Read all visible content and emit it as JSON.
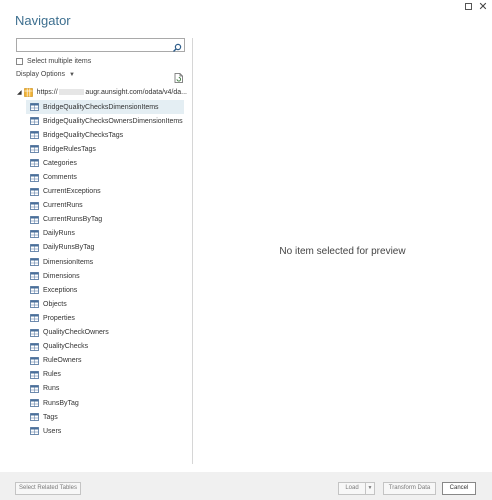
{
  "window": {
    "title": "Navigator",
    "maximize_label": "",
    "close_label": "✕"
  },
  "search": {
    "value": "",
    "placeholder": ""
  },
  "select_multiple": {
    "label": "Select multiple items",
    "checked": false
  },
  "display_options": {
    "label": "Display Options",
    "caret": "▼"
  },
  "tree": {
    "root": {
      "expander": "◢",
      "url_prefix": "https://",
      "url_suffix": "augr.aunsight.com/odata/v4/da..."
    },
    "items": [
      "BridgeQualityChecksDimensionItems",
      "BridgeQualityChecksOwnersDimensionItems",
      "BridgeQualityChecksTags",
      "BridgeRulesTags",
      "Categories",
      "Comments",
      "CurrentExceptions",
      "CurrentRuns",
      "CurrentRunsByTag",
      "DailyRuns",
      "DailyRunsByTag",
      "DimensionItems",
      "Dimensions",
      "Exceptions",
      "Objects",
      "Properties",
      "QualityCheckOwners",
      "QualityChecks",
      "RuleOwners",
      "Rules",
      "Runs",
      "RunsByTag",
      "Tags",
      "Users"
    ],
    "selected_index": 0
  },
  "preview": {
    "message": "No item selected for preview"
  },
  "footer": {
    "select_related": "Select Related Tables",
    "load": "Load",
    "load_arrow": "▼",
    "transform": "Transform Data",
    "cancel": "Cancel"
  },
  "colors": {
    "title": "#3d6f8f",
    "selected_row": "#e4eef3",
    "table_icon": "#4a6f9a"
  }
}
